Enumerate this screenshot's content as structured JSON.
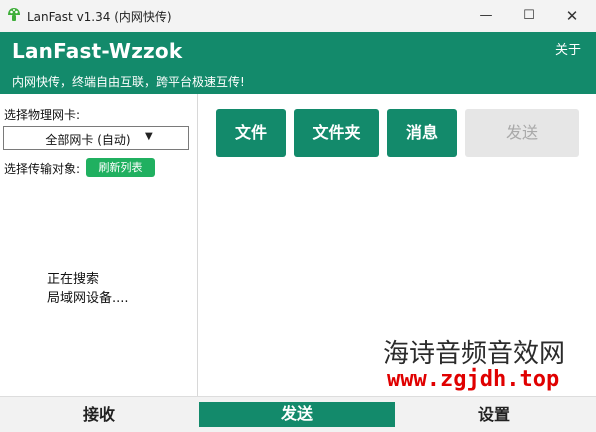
{
  "window": {
    "title": "LanFast v1.34 (内网快传)",
    "min_symbol": "—",
    "max_symbol": "☐",
    "close_symbol": "✕",
    "app_icon": "mushroom-icon"
  },
  "header": {
    "app_name": "LanFast-Wzzok",
    "about": "关于",
    "tagline": "内网快传，终端自由互联，跨平台极速互传!"
  },
  "left_panel": {
    "nic_label": "选择物理网卡:",
    "nic_selected": "全部网卡 (自动)",
    "dropdown_arrow": "▼",
    "target_label": "选择传输对象:",
    "refresh_label": "刷新列表",
    "status_line1": "正在搜索",
    "status_line2": "局域网设备...."
  },
  "actions": {
    "file": "文件",
    "folder": "文件夹",
    "message": "消息",
    "send": "发送"
  },
  "watermark": {
    "line1": "海诗音频音效网",
    "line2": "www.zgjdh.top"
  },
  "bottom_nav": {
    "receive": "接收",
    "send": "发送",
    "settings": "设置"
  },
  "colors": {
    "accent": "#138a6b",
    "refresh": "#20b060",
    "disabled": "#e6e6e6",
    "watermark_url": "#e00000"
  }
}
